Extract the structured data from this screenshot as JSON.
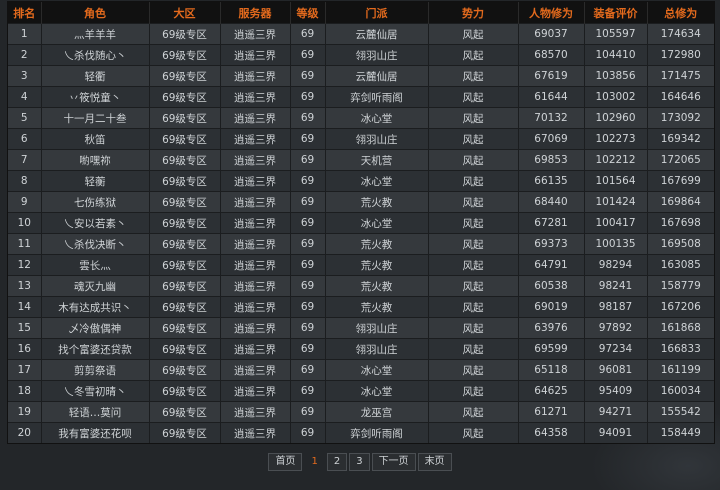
{
  "columns": [
    "排名",
    "角色",
    "大区",
    "服务器",
    "等级",
    "门派",
    "势力",
    "人物修为",
    "装备评价",
    "总修为"
  ],
  "rows": [
    [
      "1",
      "灬羊羊羊",
      "69级专区",
      "逍遥三界",
      "69",
      "云麓仙居",
      "风起",
      "69037",
      "105597",
      "174634"
    ],
    [
      "2",
      "乀杀伐随心丶",
      "69级专区",
      "逍遥三界",
      "69",
      "翎羽山庄",
      "风起",
      "68570",
      "104410",
      "172980"
    ],
    [
      "3",
      "轻衢",
      "69级专区",
      "逍遥三界",
      "69",
      "云麓仙居",
      "风起",
      "67619",
      "103856",
      "171475"
    ],
    [
      "4",
      "丷筱悦童丶",
      "69级专区",
      "逍遥三界",
      "69",
      "弈剑听雨阁",
      "风起",
      "61644",
      "103002",
      "164646"
    ],
    [
      "5",
      "十一月二十叁",
      "69级专区",
      "逍遥三界",
      "69",
      "冰心堂",
      "风起",
      "70132",
      "102960",
      "173092"
    ],
    [
      "6",
      "秋笛",
      "69级专区",
      "逍遥三界",
      "69",
      "翎羽山庄",
      "风起",
      "67069",
      "102273",
      "169342"
    ],
    [
      "7",
      "喲嘿祢",
      "69级专区",
      "逍遥三界",
      "69",
      "天机营",
      "风起",
      "69853",
      "102212",
      "172065"
    ],
    [
      "8",
      "轻蘅",
      "69级专区",
      "逍遥三界",
      "69",
      "冰心堂",
      "风起",
      "66135",
      "101564",
      "167699"
    ],
    [
      "9",
      "七伤练狱",
      "69级专区",
      "逍遥三界",
      "69",
      "荒火教",
      "风起",
      "68440",
      "101424",
      "169864"
    ],
    [
      "10",
      "乀安以若素丶",
      "69级专区",
      "逍遥三界",
      "69",
      "冰心堂",
      "风起",
      "67281",
      "100417",
      "167698"
    ],
    [
      "11",
      "乀杀伐决断丶",
      "69级专区",
      "逍遥三界",
      "69",
      "荒火教",
      "风起",
      "69373",
      "100135",
      "169508"
    ],
    [
      "12",
      "雲长灬",
      "69级专区",
      "逍遥三界",
      "69",
      "荒火教",
      "风起",
      "64791",
      "98294",
      "163085"
    ],
    [
      "13",
      "魂灭九幽",
      "69级专区",
      "逍遥三界",
      "69",
      "荒火教",
      "风起",
      "60538",
      "98241",
      "158779"
    ],
    [
      "14",
      "木有达成共识丶",
      "69级专区",
      "逍遥三界",
      "69",
      "荒火教",
      "风起",
      "69019",
      "98187",
      "167206"
    ],
    [
      "15",
      "乄冷傲偶神",
      "69级专区",
      "逍遥三界",
      "69",
      "翎羽山庄",
      "风起",
      "63976",
      "97892",
      "161868"
    ],
    [
      "16",
      "找个富婆还贷款",
      "69级专区",
      "逍遥三界",
      "69",
      "翎羽山庄",
      "风起",
      "69599",
      "97234",
      "166833"
    ],
    [
      "17",
      "剪剪祭语",
      "69级专区",
      "逍遥三界",
      "69",
      "冰心堂",
      "风起",
      "65118",
      "96081",
      "161199"
    ],
    [
      "18",
      "乀冬雪初晴丶",
      "69级专区",
      "逍遥三界",
      "69",
      "冰心堂",
      "风起",
      "64625",
      "95409",
      "160034"
    ],
    [
      "19",
      "轻语…莫问",
      "69级专区",
      "逍遥三界",
      "69",
      "龙巫宫",
      "风起",
      "61271",
      "94271",
      "155542"
    ],
    [
      "20",
      "我有富婆还花呗",
      "69级专区",
      "逍遥三界",
      "69",
      "弈剑听雨阁",
      "风起",
      "64358",
      "94091",
      "158449"
    ]
  ],
  "pagination": {
    "first": "首页",
    "pages": [
      "1",
      "2",
      "3"
    ],
    "current": "1",
    "next": "下一页",
    "last": "末页"
  },
  "colors": {
    "header_text": "#e36a1d",
    "current_page": "#e36a1d"
  }
}
